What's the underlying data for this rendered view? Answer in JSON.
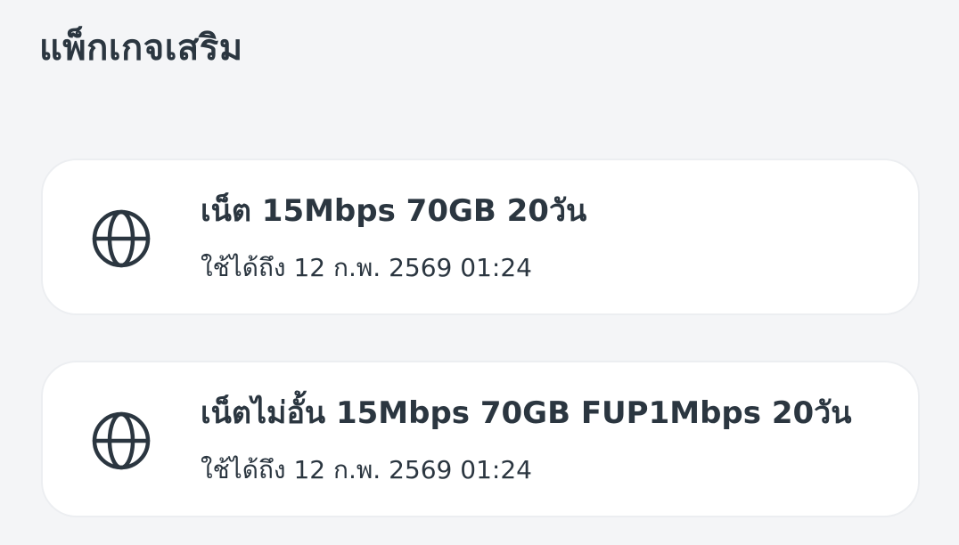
{
  "section": {
    "title": "แพ็กเกจเสริม"
  },
  "packages": [
    {
      "icon": "globe-icon",
      "name": "เน็ต 15Mbps 70GB 20วัน",
      "expiry": "ใช้ได้ถึง 12 ก.พ. 2569 01:24"
    },
    {
      "icon": "globe-icon",
      "name": "เน็ตไม่อั้น 15Mbps 70GB FUP1Mbps 20วัน",
      "expiry": "ใช้ได้ถึง 12 ก.พ. 2569 01:24"
    }
  ],
  "colors": {
    "background": "#f4f5f7",
    "card": "#ffffff",
    "text": "#2b3640"
  }
}
